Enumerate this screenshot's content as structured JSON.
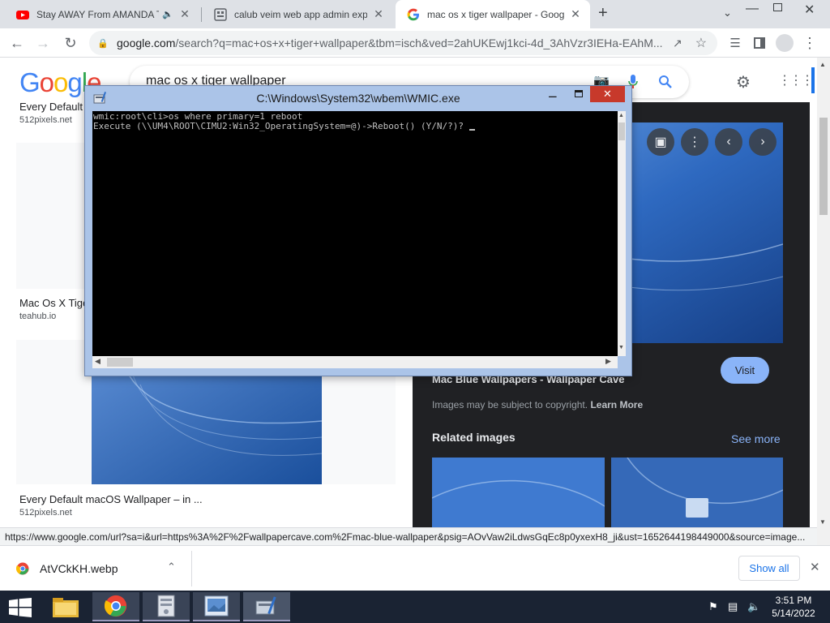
{
  "tabs": [
    {
      "title": "Stay AWAY From AMANDA T",
      "favicon": "youtube-icon",
      "muted_icon": "speaker-icon"
    },
    {
      "title": "calub veim web app admin explo",
      "favicon": "webpage-icon"
    },
    {
      "title": "mac os x tiger wallpaper - Googl",
      "favicon": "google-g-icon",
      "active": true
    }
  ],
  "new_tab_label": "+",
  "omnibox": {
    "domain": "google.com",
    "path": "/search?q=mac+os+x+tiger+wallpaper&tbm=isch&ved=2ahUKEwj1kci-4d_3AhVzr3IEHa-EAhM..."
  },
  "search": {
    "logo": "Google",
    "query": "mac os x tiger wallpaper"
  },
  "results": [
    {
      "title": "Every Default r",
      "source": "512pixels.net"
    },
    {
      "title": "Mac Os X Tige",
      "source": "teahub.io"
    },
    {
      "title": "Every Default macOS Wallpaper – in ...",
      "source": "512pixels.net"
    }
  ],
  "viewer": {
    "title": "Mac Blue Wallpapers - Wallpaper Cave",
    "visit_label": "Visit",
    "copyright": "Images may be subject to copyright.",
    "learn_more": "Learn More",
    "related_heading": "Related images",
    "see_more": "See more"
  },
  "status_url": "https://www.google.com/url?sa=i&url=https%3A%2F%2Fwallpapercave.com%2Fmac-blue-wallpaper&psig=AOvVaw2iLdwsGqEc8p0yxexH8_ji&ust=1652644198449000&source=image...",
  "console": {
    "title": "C:\\Windows\\System32\\wbem\\WMIC.exe",
    "line1": "wmic:root\\cli>os where primary=1 reboot",
    "line2": "Execute (\\\\UM4\\ROOT\\CIMU2:Win32_OperatingSystem=@)->Reboot() (Y/N/?)? "
  },
  "download": {
    "filename": "AtVCkKH.webp",
    "show_all": "Show all"
  },
  "clock": {
    "time": "3:51 PM",
    "date": "5/14/2022"
  },
  "colors": {
    "google_blue": "#4285f4",
    "google_red": "#ea4335",
    "google_yellow": "#fbbc05",
    "google_green": "#34a853",
    "visit_button": "#8ab4f8"
  }
}
